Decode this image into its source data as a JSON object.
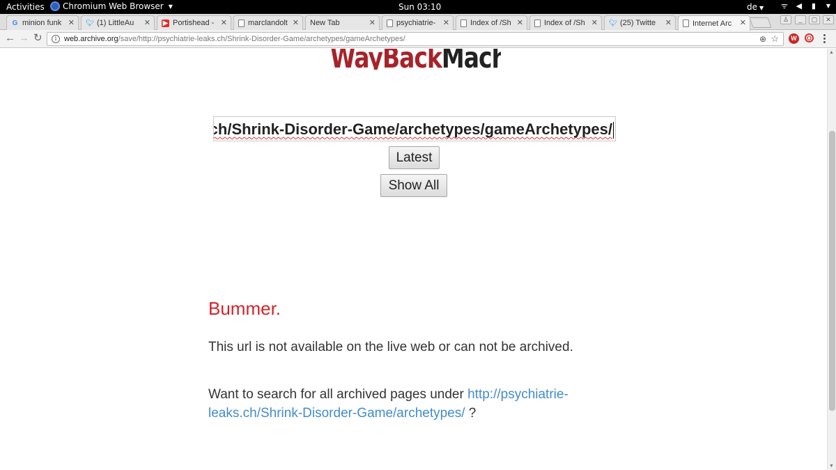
{
  "topbar": {
    "activities": "Activities",
    "app_name": "Chromium Web Browser",
    "clock": "Sun 03:10",
    "lang": "de"
  },
  "tabs": [
    {
      "title": "minion funk",
      "icon": "google-icon",
      "active": false
    },
    {
      "title": "(1) LittleAu",
      "icon": "twitter-icon",
      "active": false
    },
    {
      "title": "Portishead -",
      "icon": "youtube-icon",
      "active": false
    },
    {
      "title": "marclandolt",
      "icon": "page-icon",
      "active": false
    },
    {
      "title": "New Tab",
      "icon": "",
      "active": false
    },
    {
      "title": "psychiatrie-",
      "icon": "page-icon",
      "active": false
    },
    {
      "title": "Index of /Sh",
      "icon": "page-icon",
      "active": false
    },
    {
      "title": "Index of /Sh",
      "icon": "page-icon",
      "active": false
    },
    {
      "title": "(25) Twitte",
      "icon": "twitter-icon",
      "active": false
    },
    {
      "title": "Internet Arc",
      "icon": "page-icon",
      "active": true
    }
  ],
  "omnibox": {
    "host": "web.archive.org",
    "path": "/save/http://psychiatrie-leaks.ch/Shrink-Disorder-Game/archetypes/gameArchetypes/"
  },
  "page": {
    "logo_way": "WayBack",
    "logo_machine": "Machine",
    "search_value": "s.ch/Shrink-Disorder-Game/archetypes/gameArchetypes/",
    "latest_button": "Latest",
    "show_all_button": "Show All",
    "bummer": "Bummer.",
    "message": "This url is not available on the live web or can not be archived.",
    "search_prompt": "Want to search for all archived pages under",
    "search_link": "http://psychiatrie-leaks.ch/Shrink-Disorder-Game/archetypes/",
    "search_suffix": " ?"
  },
  "colors": {
    "bummer": "#d2232a",
    "link": "#428bca",
    "logo_red": "#a7232a"
  }
}
